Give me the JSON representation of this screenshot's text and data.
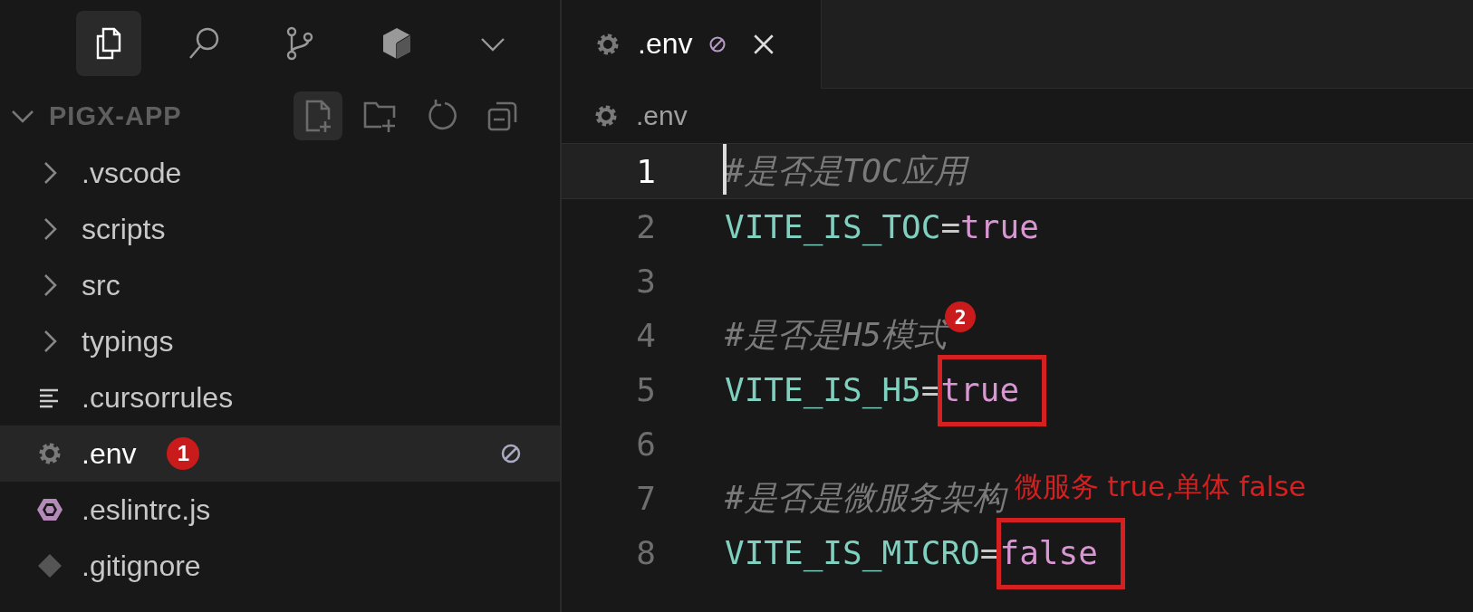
{
  "activity_bar": [
    {
      "selected": true
    },
    {
      "selected": false
    },
    {
      "selected": false
    },
    {
      "selected": false
    },
    {
      "selected": false
    }
  ],
  "explorer": {
    "title": "PIGX-APP",
    "expanded": true,
    "items": [
      {
        "name": ".vscode",
        "kind": "folder",
        "selected": false,
        "ignored": false
      },
      {
        "name": "scripts",
        "kind": "folder",
        "selected": false,
        "ignored": false
      },
      {
        "name": "src",
        "kind": "folder",
        "selected": false,
        "ignored": false
      },
      {
        "name": "typings",
        "kind": "folder",
        "selected": false,
        "ignored": false
      },
      {
        "name": ".cursorrules",
        "kind": "text",
        "selected": false,
        "ignored": false
      },
      {
        "name": ".env",
        "kind": "config",
        "selected": true,
        "ignored": true,
        "badge": "1"
      },
      {
        "name": ".eslintrc.js",
        "kind": "eslint",
        "selected": false,
        "ignored": false
      },
      {
        "name": ".gitignore",
        "kind": "git",
        "selected": false,
        "ignored": false
      }
    ]
  },
  "tabs": [
    {
      "label": ".env",
      "selected": true,
      "ignored": true
    }
  ],
  "breadcrumb": ".env",
  "lines": [
    {
      "number": "1",
      "kind": "comment",
      "text": "#是否是TOC应用",
      "current": true
    },
    {
      "number": "2",
      "kind": "assign",
      "key": "VITE_IS_TOC",
      "op": "=",
      "value": "true",
      "current": false
    },
    {
      "number": "3",
      "kind": "blank",
      "current": false
    },
    {
      "number": "4",
      "kind": "comment",
      "text": "#是否是H5模式",
      "badge": "2",
      "current": false
    },
    {
      "number": "5",
      "kind": "assign",
      "key": "VITE_IS_H5",
      "op": "=",
      "value": "true",
      "boxed": true,
      "current": false
    },
    {
      "number": "6",
      "kind": "blank",
      "current": false
    },
    {
      "number": "7",
      "kind": "comment",
      "text": "#是否是微服务架构",
      "note": "微服务 true,单体 false",
      "current": false
    },
    {
      "number": "8",
      "kind": "assign",
      "key": "VITE_IS_MICRO",
      "op": "=",
      "value": "false",
      "boxed": true,
      "current": false
    }
  ]
}
